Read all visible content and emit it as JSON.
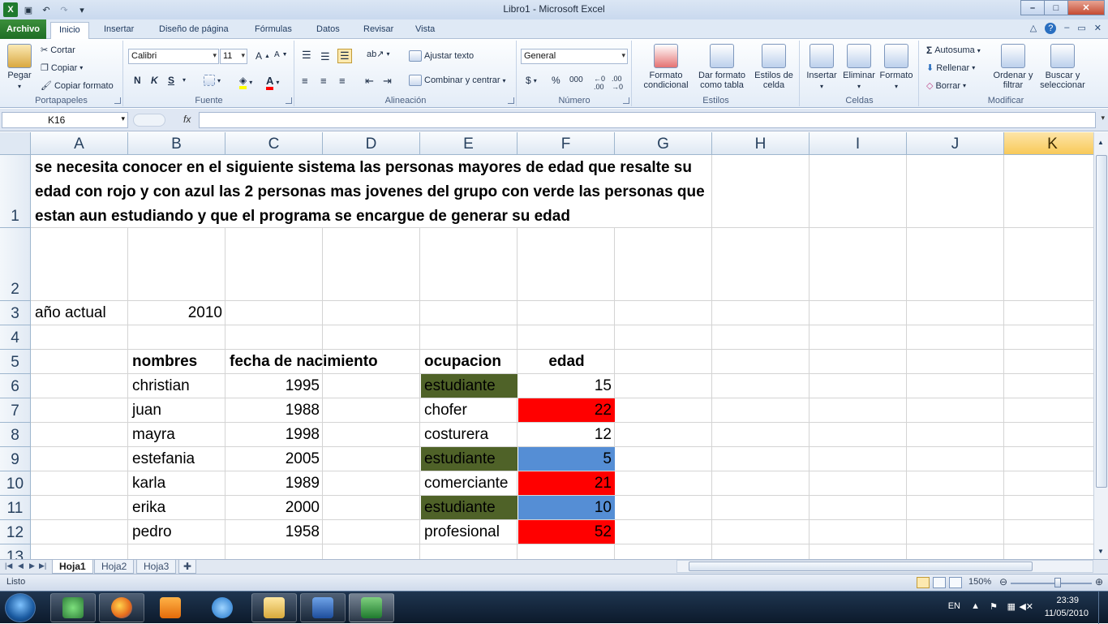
{
  "window": {
    "title": "Libro1  -  Microsoft Excel",
    "controls": [
      "–",
      "□",
      "✕"
    ]
  },
  "tabs": [
    {
      "label": "Archivo"
    },
    {
      "label": "Inicio"
    },
    {
      "label": "Insertar"
    },
    {
      "label": "Diseño de página"
    },
    {
      "label": "Fórmulas"
    },
    {
      "label": "Datos"
    },
    {
      "label": "Revisar"
    },
    {
      "label": "Vista"
    }
  ],
  "ribbon": {
    "clipboard": {
      "paste": "Pegar",
      "cut": "Cortar",
      "copy": "Copiar",
      "format_painter": "Copiar formato",
      "label": "Portapapeles"
    },
    "font": {
      "name": "Calibri",
      "size": "11",
      "bold": "N",
      "italic": "K",
      "underline": "S",
      "label": "Fuente"
    },
    "alignment": {
      "wrap": "Ajustar texto",
      "merge": "Combinar y centrar",
      "label": "Alineación"
    },
    "number": {
      "format": "General",
      "currency": "$",
      "percent": "%",
      "thousands": "000",
      "label": "Número"
    },
    "styles": {
      "conditional": "Formato condicional",
      "table": "Dar formato como tabla",
      "cell_styles": "Estilos de celda",
      "label": "Estilos"
    },
    "cells": {
      "insert": "Insertar",
      "delete": "Eliminar",
      "format": "Formato",
      "label": "Celdas"
    },
    "editing": {
      "autosum": "Autosuma",
      "fill": "Rellenar",
      "clear": "Borrar",
      "sort": "Ordenar y filtrar",
      "find": "Buscar y seleccionar",
      "label": "Modificar"
    }
  },
  "formula_bar": {
    "name_box": "K16",
    "fx": "fx",
    "formula": ""
  },
  "columns": [
    "A",
    "B",
    "C",
    "D",
    "E",
    "F",
    "G",
    "H",
    "I",
    "J",
    "K"
  ],
  "rows": [
    "1",
    "2",
    "3",
    "4",
    "5",
    "6",
    "7",
    "8",
    "9",
    "10",
    "11",
    "12",
    "13"
  ],
  "sheet": {
    "title": "se necesita conocer en el siguiente sistema las personas mayores de edad que resalte su edad con rojo y con azul las 2 personas mas jovenes del grupo con verde las personas que estan aun estudiando y que el programa se encargue de generar su edad",
    "year_label": "año actual",
    "year_value": "2010",
    "headers": {
      "name": "nombres",
      "birth": "fecha de nacimiento",
      "occupation": "ocupacion",
      "age": "edad"
    },
    "records": [
      {
        "name": "christian",
        "birth": "1995",
        "occupation": "estudiante",
        "age": "15",
        "occ_fill": "#4f6228",
        "age_fill": ""
      },
      {
        "name": "juan",
        "birth": "1988",
        "occupation": "chofer",
        "age": "22",
        "occ_fill": "",
        "age_fill": "#ff0000"
      },
      {
        "name": "mayra",
        "birth": "1998",
        "occupation": "costurera",
        "age": "12",
        "occ_fill": "",
        "age_fill": ""
      },
      {
        "name": "estefania",
        "birth": "2005",
        "occupation": "estudiante",
        "age": "5",
        "occ_fill": "#4f6228",
        "age_fill": "#558ed5"
      },
      {
        "name": "karla",
        "birth": "1989",
        "occupation": "comerciante",
        "age": "21",
        "occ_fill": "",
        "age_fill": "#ff0000"
      },
      {
        "name": "erika",
        "birth": "2000",
        "occupation": "estudiante",
        "age": "10",
        "occ_fill": "#4f6228",
        "age_fill": "#558ed5"
      },
      {
        "name": "pedro",
        "birth": "1958",
        "occupation": "profesional",
        "age": "52",
        "occ_fill": "",
        "age_fill": "#ff0000"
      }
    ]
  },
  "sheet_tabs": [
    "Hoja1",
    "Hoja2",
    "Hoja3"
  ],
  "status": {
    "text": "Listo",
    "zoom": "150%"
  },
  "taskbar": {
    "lang": "EN",
    "time": "23:39",
    "date": "11/05/2010"
  }
}
